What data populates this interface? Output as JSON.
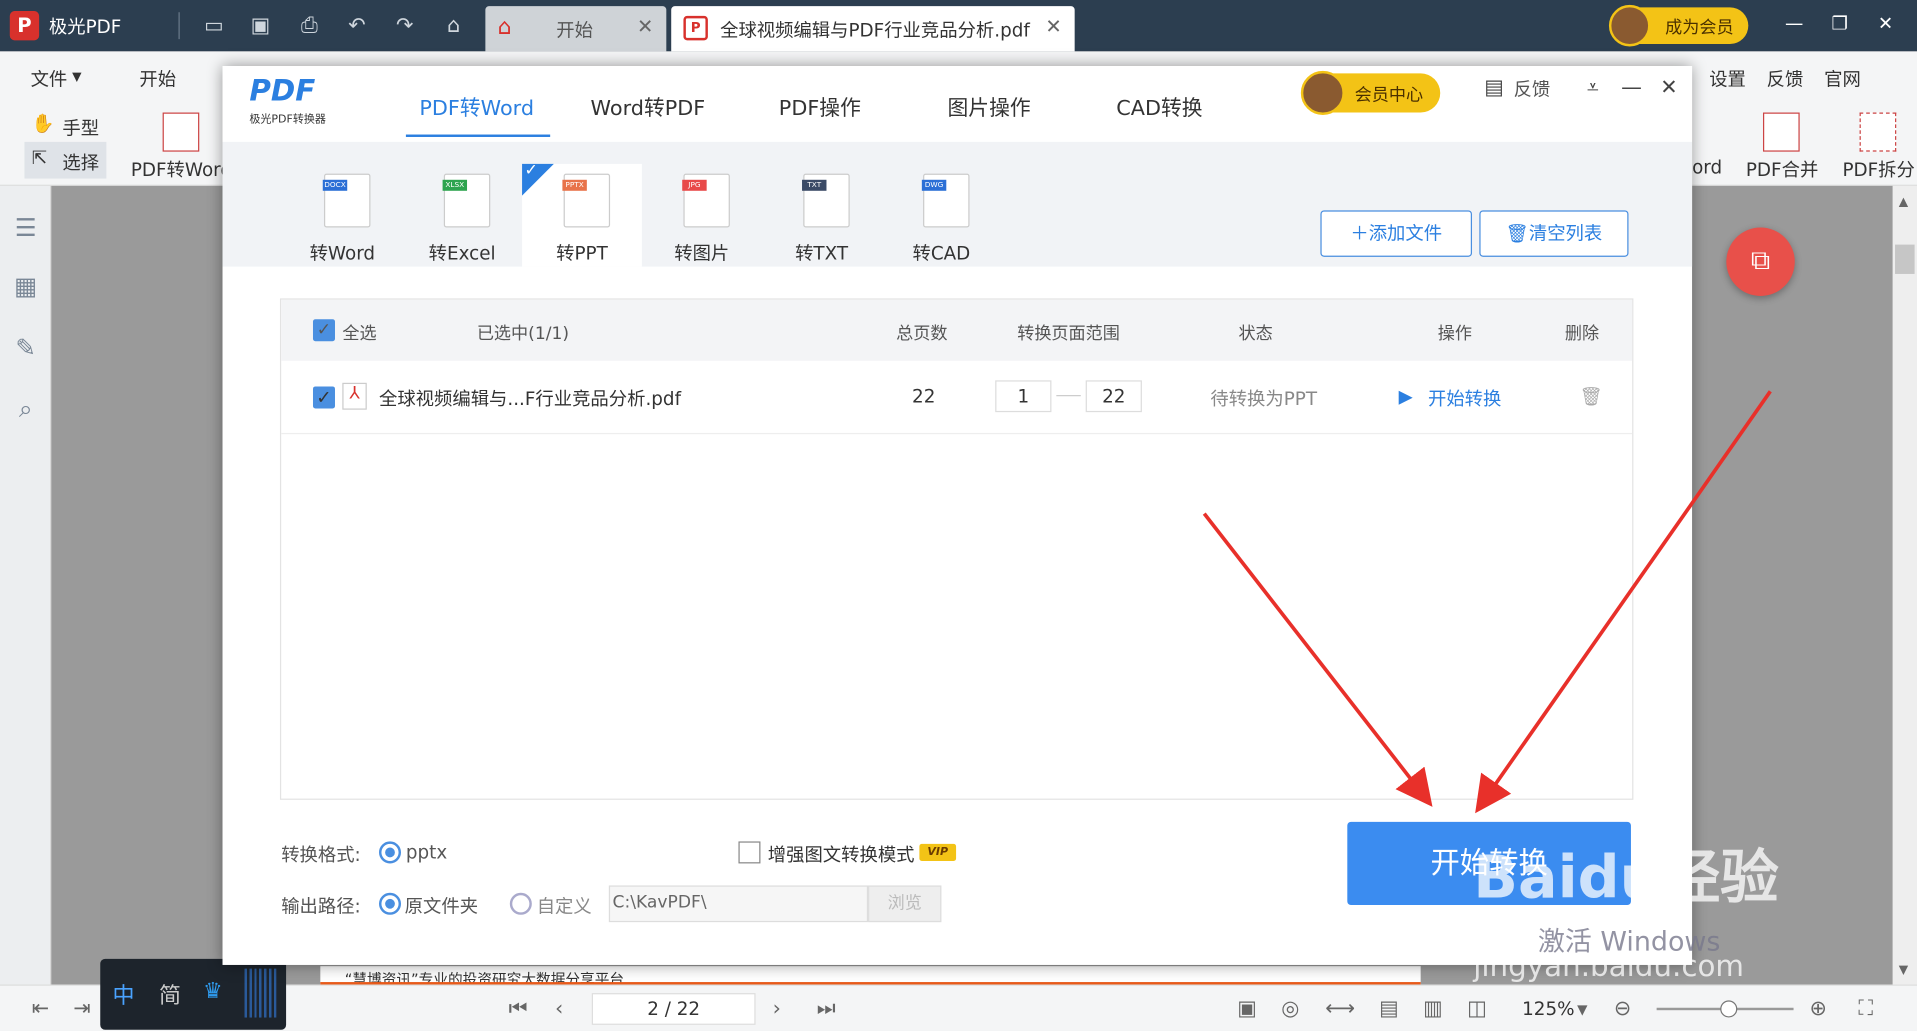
{
  "titlebar": {
    "app_name": "极光PDF",
    "logo": "P",
    "tab_home": "开始",
    "tab_doc": "全球视频编辑与PDF行业竞品分析.pdf",
    "member": "成为会员"
  },
  "ribbon": {
    "menu_file": "文件",
    "menu_start": "开始",
    "hand": "手型",
    "select": "选择",
    "pdf2word": "PDF转Word",
    "right_menu": [
      "设置",
      "反馈",
      "官网"
    ],
    "merge": "PDF合并",
    "split": "PDF拆分",
    "ord_partial": "ord"
  },
  "status": {
    "page": "2 / 22",
    "zoom": "125%"
  },
  "ime": {
    "zh": "中",
    "jian": "简"
  },
  "document": {
    "footer_text": "“慧博资讯”专业的投资研究大数据分享平台"
  },
  "dialog": {
    "logo": "PDF",
    "logo_sub": "极光PDF转换器",
    "nav": [
      "PDF转Word",
      "Word转PDF",
      "PDF操作",
      "图片操作",
      "CAD转换"
    ],
    "vip_center": "会员中心",
    "feedback": "反馈",
    "types": [
      {
        "label": "转Word",
        "tag": "DOCX",
        "color": "#2b6fd6"
      },
      {
        "label": "转Excel",
        "tag": "XLSX",
        "color": "#2ea44f"
      },
      {
        "label": "转PPT",
        "tag": "PPTX",
        "color": "#e8734a"
      },
      {
        "label": "转图片",
        "tag": "JPG",
        "color": "#e84a4a"
      },
      {
        "label": "转TXT",
        "tag": "TXT",
        "color": "#3a4a66"
      },
      {
        "label": "转CAD",
        "tag": "DWG",
        "color": "#2b6fd6"
      }
    ],
    "add_file": "添加文件",
    "clear_list": "清空列表",
    "table": {
      "select_all": "全选",
      "selected": "已选中(1/1)",
      "col_pages": "总页数",
      "col_range": "转换页面范围",
      "col_status": "状态",
      "col_action": "操作",
      "col_delete": "删除",
      "rows": [
        {
          "name": "全球视频编辑与...F行业竞品分析.pdf",
          "pages": "22",
          "from": "1",
          "to": "22",
          "status": "待转换为PPT",
          "action": "开始转换"
        }
      ]
    },
    "format_label": "转换格式:",
    "format_value": "pptx",
    "enhance": "增强图文转换模式",
    "vip_badge": "VIP",
    "output_label": "输出路径:",
    "opt_source": "原文件夹",
    "opt_custom": "自定义",
    "path_value": "C:\\KavPDF\\",
    "browse": "浏览",
    "start_button": "开始转换"
  },
  "watermark": {
    "main": "Baidu经验",
    "url": "jingyan.baidu.com",
    "activate": "激活 Windows"
  }
}
